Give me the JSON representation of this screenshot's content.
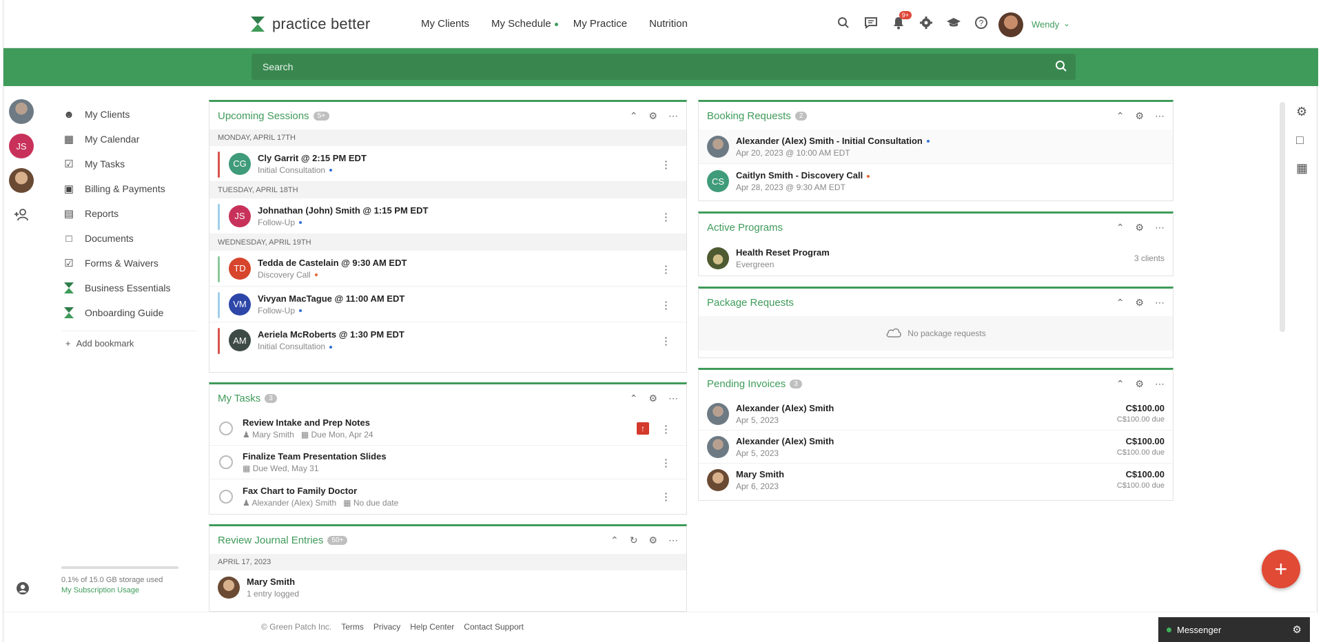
{
  "app": {
    "logo_text": "practice better",
    "brand_color": "#3f9b5a",
    "accent_color": "#e14a35"
  },
  "nav": [
    {
      "label": "My Clients"
    },
    {
      "label": "My Schedule"
    },
    {
      "label": "My Practice"
    },
    {
      "label": "Nutrition"
    }
  ],
  "header": {
    "notification_count": "9+",
    "user_name": "Wendy"
  },
  "search": {
    "placeholder": "Search"
  },
  "rail": {
    "initials": "JS"
  },
  "sidebar": {
    "items": [
      {
        "label": "My Clients",
        "icon": "clients-icon"
      },
      {
        "label": "My Calendar",
        "icon": "calendar-icon"
      },
      {
        "label": "My Tasks",
        "icon": "tasks-icon"
      },
      {
        "label": "Billing & Payments",
        "icon": "billing-icon"
      },
      {
        "label": "Reports",
        "icon": "reports-icon"
      },
      {
        "label": "Documents",
        "icon": "folder-icon"
      },
      {
        "label": "Forms & Waivers",
        "icon": "forms-icon"
      },
      {
        "label": "Business Essentials",
        "icon": "hourglass-icon"
      },
      {
        "label": "Onboarding Guide",
        "icon": "hourglass-icon"
      }
    ],
    "add_bookmark": "Add bookmark",
    "storage_text": "0.1% of 15.0 GB storage used",
    "storage_link": "My Subscription Usage"
  },
  "upcoming": {
    "title": "Upcoming Sessions",
    "count": "5+",
    "days": [
      {
        "label": "MONDAY, APRIL 17TH",
        "sessions": [
          {
            "initials": "CG",
            "color": "#3f9b7a",
            "bar": "#d9534f",
            "title": "Cly Garrit @ 2:15 PM EDT",
            "type": "Initial Consultation",
            "dot": "#2f6fd6"
          }
        ]
      },
      {
        "label": "TUESDAY, APRIL 18TH",
        "sessions": [
          {
            "initials": "JS",
            "color": "#c8315a",
            "bar": "#9fcfe8",
            "title": "Johnathan (John) Smith @ 1:15 PM EDT",
            "type": "Follow-Up",
            "dot": "#2f6fd6"
          }
        ]
      },
      {
        "label": "WEDNESDAY, APRIL 19TH",
        "sessions": [
          {
            "initials": "TD",
            "color": "#d6452c",
            "bar": "#8bc89a",
            "title": "Tedda de Castelain @ 9:30 AM EDT",
            "type": "Discovery Call",
            "dot": "#e0632d"
          },
          {
            "initials": "VM",
            "color": "#2d46a8",
            "bar": "#9fcfe8",
            "title": "Vivyan MacTague @ 11:00 AM EDT",
            "type": "Follow-Up",
            "dot": "#2f6fd6"
          },
          {
            "initials": "AM",
            "color": "#3d4a46",
            "bar": "#d9534f",
            "title": "Aeriela McRoberts @ 1:30 PM EDT",
            "type": "Initial Consultation",
            "dot": "#2f6fd6"
          }
        ]
      }
    ]
  },
  "tasks": {
    "title": "My Tasks",
    "count": "3",
    "items": [
      {
        "title": "Review Intake and Prep Notes",
        "assignee": "Mary Smith",
        "due": "Due Mon, Apr 24",
        "priority": true
      },
      {
        "title": "Finalize Team Presentation Slides",
        "assignee": "",
        "due": "Due Wed, May 31",
        "priority": false
      },
      {
        "title": "Fax Chart to Family Doctor",
        "assignee": "Alexander (Alex) Smith",
        "due": "No due date",
        "priority": false
      }
    ]
  },
  "journal": {
    "title": "Review Journal Entries",
    "count": "50+",
    "date": "APRIL 17, 2023",
    "entry_name": "Mary Smith",
    "entry_meta": "1 entry logged"
  },
  "booking": {
    "title": "Booking Requests",
    "count": "2",
    "items": [
      {
        "title": "Alexander (Alex) Smith - Initial Consultation",
        "date": "Apr 20, 2023 @ 10:00 AM EDT",
        "dot": "#2f6fd6",
        "initials": ""
      },
      {
        "title": "Caitlyn Smith - Discovery Call",
        "date": "Apr 28, 2023 @ 9:30 AM EDT",
        "dot": "#e0632d",
        "initials": "CS"
      }
    ]
  },
  "programs": {
    "title": "Active Programs",
    "items": [
      {
        "name": "Health Reset Program",
        "sub": "Evergreen",
        "clients": "3 clients"
      }
    ]
  },
  "packages": {
    "title": "Package Requests",
    "empty_text": "No package requests"
  },
  "invoices": {
    "title": "Pending Invoices",
    "count": "3",
    "items": [
      {
        "name": "Alexander (Alex) Smith",
        "date": "Apr 5, 2023",
        "amount": "C$100.00",
        "due": "C$100.00 due"
      },
      {
        "name": "Alexander (Alex) Smith",
        "date": "Apr 5, 2023",
        "amount": "C$100.00",
        "due": "C$100.00 due"
      },
      {
        "name": "Mary Smith",
        "date": "Apr 6, 2023",
        "amount": "C$100.00",
        "due": "C$100.00 due"
      }
    ]
  },
  "footer": {
    "copyright": "© Green Patch Inc.",
    "links": [
      "Terms",
      "Privacy",
      "Help Center",
      "Contact Support"
    ],
    "messenger": "Messenger"
  }
}
